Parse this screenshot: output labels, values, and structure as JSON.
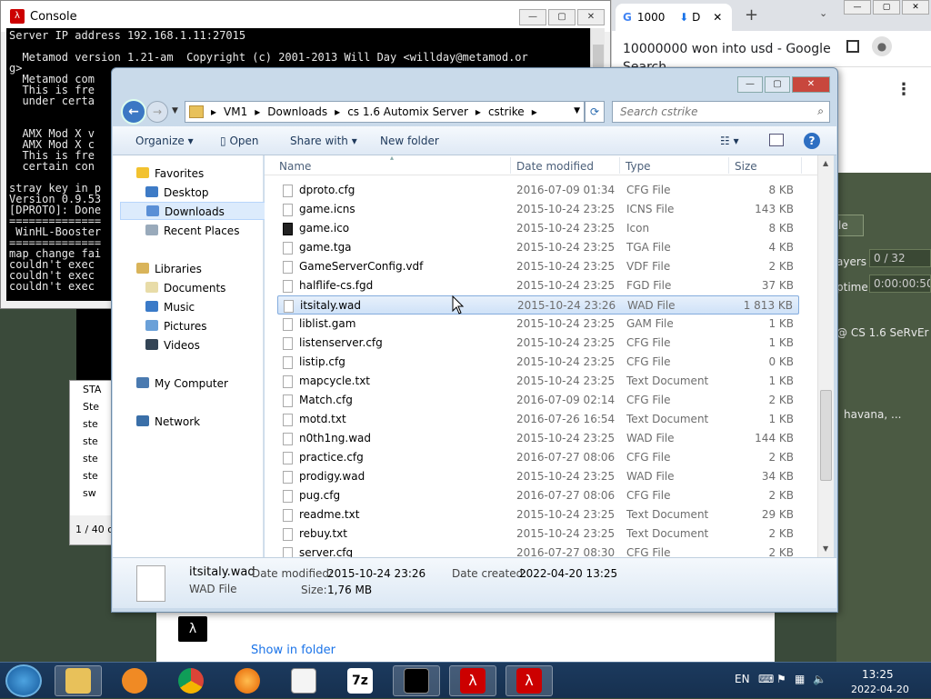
{
  "console": {
    "title": "Console",
    "lines": [
      "Server IP address 192.168.1.11:27015",
      "",
      "  Metamod version 1.21-am  Copyright (c) 2001-2013 Will Day <willday@metamod.or",
      "g>",
      "  Metamod com",
      "  This is fre",
      "  under certa",
      "",
      "",
      "  AMX Mod X v",
      "  AMX Mod X c",
      "  This is fre",
      "  certain con",
      "",
      "stray key in p",
      "Version 0.9.53",
      "[DPROTO]: Done",
      "==============",
      " WinHL-Booster",
      "==============",
      "map change fai",
      "couldn't exec",
      "couldn't exec",
      "couldn't exec"
    ]
  },
  "leftpanel": {
    "items": [
      "STA",
      "Ste",
      "ste",
      "ste",
      "ste",
      "ste",
      "sw"
    ],
    "count": "1 / 40 c"
  },
  "chrome": {
    "tab_title": "1000",
    "tab2_label": "D",
    "page_title": "10000000 won into usd - Google",
    "page_sub": "Search",
    "show_in_folder": "Show in folder"
  },
  "gamepanel": {
    "tab": "le",
    "players_label": "ayers",
    "players_value": "0 / 32",
    "uptime_label": "ptime",
    "uptime_value": "0:00:00:50",
    "server_name": "@ CS 1.6 SeRvEr",
    "map_line": "havana, ..."
  },
  "explorer": {
    "breadcrumb": [
      "VM1",
      "Downloads",
      "cs 1.6 Automix Server",
      "cstrike"
    ],
    "search_placeholder": "Search cstrike",
    "toolbar": {
      "organize": "Organize",
      "open": "Open",
      "share": "Share with",
      "newfolder": "New folder"
    },
    "nav": {
      "favorites": "Favorites",
      "desktop": "Desktop",
      "downloads": "Downloads",
      "recent": "Recent Places",
      "libraries": "Libraries",
      "documents": "Documents",
      "music": "Music",
      "pictures": "Pictures",
      "videos": "Videos",
      "computer": "My Computer",
      "network": "Network"
    },
    "columns": {
      "name": "Name",
      "date": "Date modified",
      "type": "Type",
      "size": "Size"
    },
    "files": [
      {
        "name": "dproto.cfg",
        "date": "2016-07-09 01:34",
        "type": "CFG File",
        "size": "8 KB"
      },
      {
        "name": "game.icns",
        "date": "2015-10-24 23:25",
        "type": "ICNS File",
        "size": "143 KB"
      },
      {
        "name": "game.ico",
        "date": "2015-10-24 23:25",
        "type": "Icon",
        "size": "8 KB"
      },
      {
        "name": "game.tga",
        "date": "2015-10-24 23:25",
        "type": "TGA File",
        "size": "4 KB"
      },
      {
        "name": "GameServerConfig.vdf",
        "date": "2015-10-24 23:25",
        "type": "VDF File",
        "size": "2 KB"
      },
      {
        "name": "halflife-cs.fgd",
        "date": "2015-10-24 23:25",
        "type": "FGD File",
        "size": "37 KB"
      },
      {
        "name": "itsitaly.wad",
        "date": "2015-10-24 23:26",
        "type": "WAD File",
        "size": "1 813 KB"
      },
      {
        "name": "liblist.gam",
        "date": "2015-10-24 23:25",
        "type": "GAM File",
        "size": "1 KB"
      },
      {
        "name": "listenserver.cfg",
        "date": "2015-10-24 23:25",
        "type": "CFG File",
        "size": "1 KB"
      },
      {
        "name": "listip.cfg",
        "date": "2015-10-24 23:25",
        "type": "CFG File",
        "size": "0 KB"
      },
      {
        "name": "mapcycle.txt",
        "date": "2015-10-24 23:25",
        "type": "Text Document",
        "size": "1 KB"
      },
      {
        "name": "Match.cfg",
        "date": "2016-07-09 02:14",
        "type": "CFG File",
        "size": "2 KB"
      },
      {
        "name": "motd.txt",
        "date": "2016-07-26 16:54",
        "type": "Text Document",
        "size": "1 KB"
      },
      {
        "name": "n0th1ng.wad",
        "date": "2015-10-24 23:25",
        "type": "WAD File",
        "size": "144 KB"
      },
      {
        "name": "practice.cfg",
        "date": "2016-07-27 08:06",
        "type": "CFG File",
        "size": "2 KB"
      },
      {
        "name": "prodigy.wad",
        "date": "2015-10-24 23:25",
        "type": "WAD File",
        "size": "34 KB"
      },
      {
        "name": "pug.cfg",
        "date": "2016-07-27 08:06",
        "type": "CFG File",
        "size": "2 KB"
      },
      {
        "name": "readme.txt",
        "date": "2015-10-24 23:25",
        "type": "Text Document",
        "size": "29 KB"
      },
      {
        "name": "rebuy.txt",
        "date": "2015-10-24 23:25",
        "type": "Text Document",
        "size": "2 KB"
      },
      {
        "name": "server.cfg",
        "date": "2016-07-27 08:30",
        "type": "CFG File",
        "size": "2 KB"
      }
    ],
    "details": {
      "name": "itsitaly.wad",
      "type": "WAD File",
      "modified_label": "Date modified:",
      "modified": "2015-10-24 23:26",
      "created_label": "Date created:",
      "created": "2022-04-20 13:25",
      "size_label": "Size:",
      "size": "1,76 MB"
    }
  },
  "taskbar": {
    "lang": "EN",
    "time": "13:25",
    "date": "2022-04-20",
    "apps": [
      "explorer",
      "media-player",
      "chrome",
      "firefox",
      "notepad",
      "7zip",
      "cmd",
      "hlds",
      "half-life"
    ]
  },
  "colors": {
    "selection": "#cfe2f8",
    "taskbar": "#1c3a5e",
    "game_panel": "#4b5a43"
  }
}
